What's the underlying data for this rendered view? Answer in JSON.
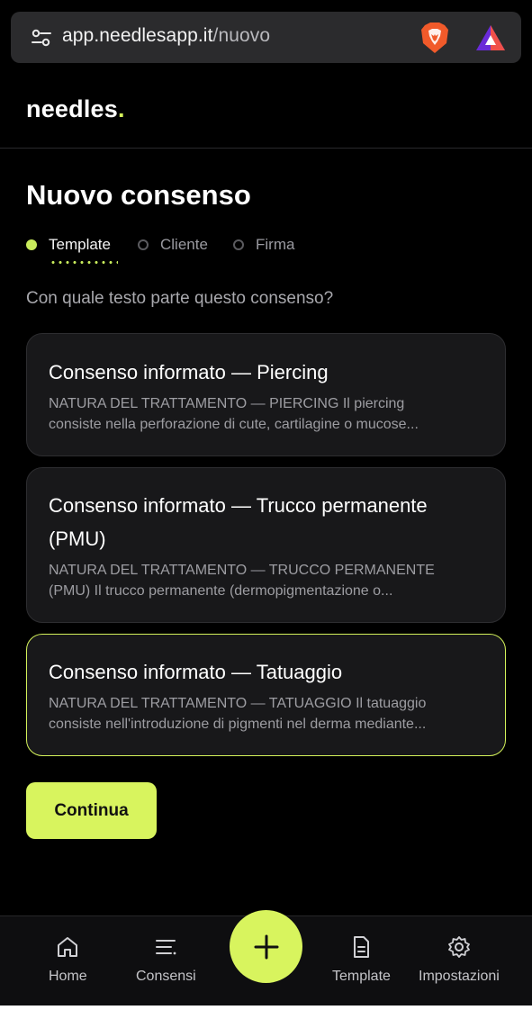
{
  "browser": {
    "url_host": "app.needlesapp.it",
    "url_path": "/nuovo"
  },
  "app": {
    "logo_text": "needles",
    "logo_dot": "."
  },
  "page": {
    "title": "Nuovo consenso",
    "question": "Con quale testo parte questo consenso?"
  },
  "steps": [
    {
      "label": "Template",
      "state": "active"
    },
    {
      "label": "Cliente",
      "state": "inactive"
    },
    {
      "label": "Firma",
      "state": "inactive"
    }
  ],
  "templates": [
    {
      "title": "Consenso informato — Piercing",
      "desc_line1": "NATURA DEL TRATTAMENTO — PIERCING Il piercing",
      "desc_line2": "consiste nella perforazione di cute, cartilagine o mucose...",
      "selected": false
    },
    {
      "title_line1": "Consenso informato — Trucco permanente",
      "title_line2": "(PMU)",
      "desc_line1": "NATURA DEL TRATTAMENTO — TRUCCO PERMANENTE",
      "desc_line2": "(PMU) Il trucco permanente (dermopigmentazione o...",
      "selected": false
    },
    {
      "title": "Consenso informato — Tatuaggio",
      "desc_line1": "NATURA DEL TRATTAMENTO — TATUAGGIO Il tatuaggio",
      "desc_line2": "consiste nell'introduzione di pigmenti nel derma mediante...",
      "selected": true
    }
  ],
  "actions": {
    "continue_label": "Continua"
  },
  "nav": {
    "home": "Home",
    "consensi": "Consensi",
    "template": "Template",
    "impostazioni": "Impostazioni",
    "fab_icon": "plus-icon"
  },
  "colors": {
    "accent": "#d8f45e",
    "background": "#000000",
    "card": "#18181a"
  }
}
